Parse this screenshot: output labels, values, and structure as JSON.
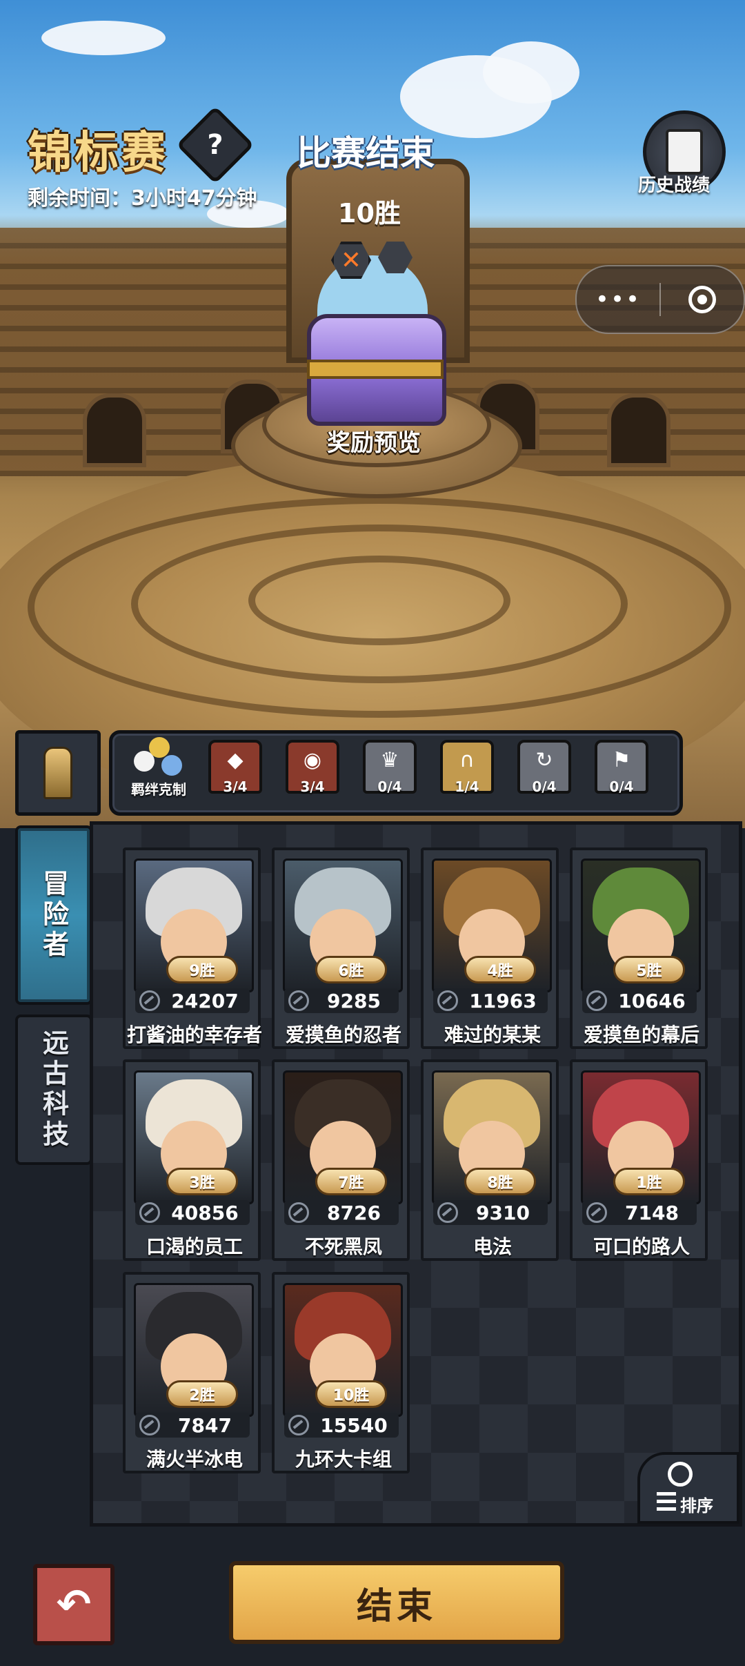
{
  "header": {
    "title": "锦标赛",
    "help_symbol": "?",
    "remaining_time": "剩余时间：3小时47分钟",
    "status": "比赛结束",
    "wins": "10胜",
    "history_label": "历史战绩",
    "capsule_menu_symbol": "•••"
  },
  "reward": {
    "label": "奖励预览"
  },
  "synergy": {
    "label": "羁绊克制",
    "items": [
      {
        "count": "3/4",
        "icon": "crystal-icon",
        "color": "#8a3a2c"
      },
      {
        "count": "3/4",
        "icon": "eye-icon",
        "color": "#8a3a2c"
      },
      {
        "count": "0/4",
        "icon": "crown-icon",
        "color": "#6b6f78"
      },
      {
        "count": "1/4",
        "icon": "arch-icon",
        "color": "#c29a4e"
      },
      {
        "count": "0/4",
        "icon": "swirl-icon",
        "color": "#6b6f78"
      },
      {
        "count": "0/4",
        "icon": "banner-icon",
        "color": "#6b6f78"
      }
    ]
  },
  "tabs": [
    {
      "label": "冒险者",
      "active": true
    },
    {
      "label": "远古科技",
      "active": false
    }
  ],
  "roster": [
    {
      "name": "打酱油的幸存者",
      "wins": "9胜",
      "power": "24207",
      "hair": "#d8d8d8",
      "bg": "#5a6a80"
    },
    {
      "name": "爱摸鱼的忍者",
      "wins": "6胜",
      "power": "9285",
      "hair": "#b7c3c9",
      "bg": "#4b5c6a"
    },
    {
      "name": "难过的某某",
      "wins": "4胜",
      "power": "11963",
      "hair": "#a2743c",
      "bg": "#6c4a26"
    },
    {
      "name": "爱摸鱼的幕后",
      "wins": "5胜",
      "power": "10646",
      "hair": "#5f8a3a",
      "bg": "#2a2f25"
    },
    {
      "name": "口渴的员工",
      "wins": "3胜",
      "power": "40856",
      "hair": "#ece4d6",
      "bg": "#6a7a8a"
    },
    {
      "name": "不死黑凤",
      "wins": "7胜",
      "power": "8726",
      "hair": "#3a2e26",
      "bg": "#2a1e18"
    },
    {
      "name": "电法",
      "wins": "8胜",
      "power": "9310",
      "hair": "#d8b770",
      "bg": "#7a6a50"
    },
    {
      "name": "可口的路人",
      "wins": "1胜",
      "power": "7148",
      "hair": "#c0444a",
      "bg": "#7a2b30"
    },
    {
      "name": "满火半冰电",
      "wins": "2胜",
      "power": "7847",
      "hair": "#2a2a2e",
      "bg": "#4a4a52"
    },
    {
      "name": "九环大卡组",
      "wins": "10胜",
      "power": "15540",
      "hair": "#9a3a2a",
      "bg": "#5a2a1e"
    }
  ],
  "sort": {
    "label": "排序"
  },
  "footer": {
    "back_symbol": "↶",
    "end_label": "结束"
  }
}
